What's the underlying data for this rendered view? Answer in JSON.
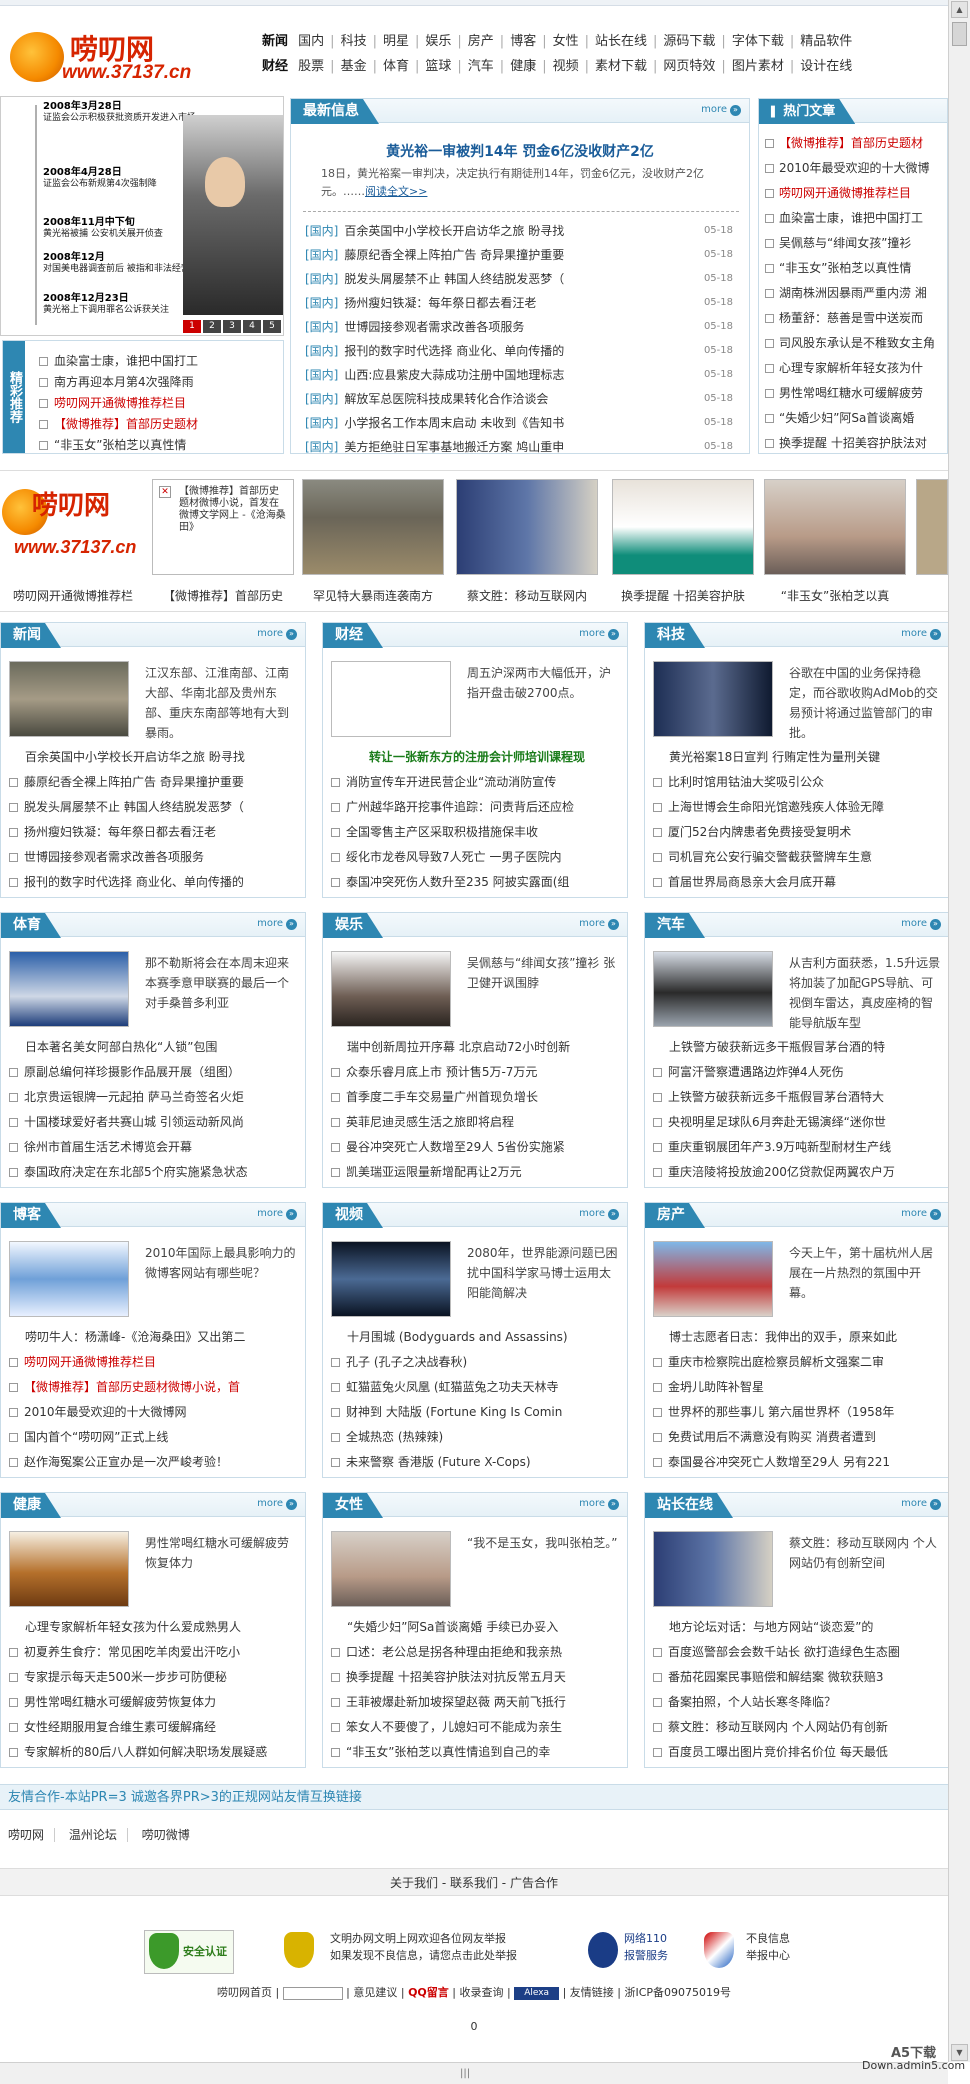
{
  "header": {
    "logo_text": "唠叨网",
    "logo_url": "www.37137.cn",
    "nav_row1": {
      "group": "新闻",
      "items": [
        "国内",
        "科技",
        "明星",
        "娱乐",
        "房产",
        "博客",
        "女性",
        "站长在线",
        "源码下载",
        "字体下载",
        "精品软件"
      ]
    },
    "nav_row2": {
      "group": "财经",
      "items": [
        "股票",
        "基金",
        "体育",
        "篮球",
        "汽车",
        "健康",
        "视频",
        "素材下载",
        "网页特效",
        "图片素材",
        "设计在线"
      ]
    }
  },
  "timeline": {
    "items": [
      {
        "date": "2008年3月28日",
        "text": "证监会公示积极获批资质开发进入市场"
      },
      {
        "date": "2008年4月28日",
        "text": "证监会公布新规第4次强制降"
      },
      {
        "date": "2008年11月中下旬",
        "text": "黄光裕被捕 公安机关展开侦查"
      },
      {
        "date": "2008年12月",
        "text": "对国美电器调查前后 被指和非法经营罪起诉"
      },
      {
        "date": "2008年12月23日",
        "text": "黄光裕上下调用罪名公诉获关注"
      }
    ],
    "pager": [
      "1",
      "2",
      "3",
      "4",
      "5"
    ]
  },
  "featured": {
    "label": "精彩推荐",
    "items": [
      "血染富士康，谁把中国打工",
      "南方再迎本月第4次强降雨",
      "唠叨网开通微博推荐栏目",
      "【微博推荐】首部历史题材",
      "“非玉女”张柏芝以真性情"
    ]
  },
  "latest": {
    "title": "最新信息",
    "more": "more",
    "lead_title": "黄光裕一审被判14年 罚金6亿没收财产2亿",
    "lead_summary": "18日，黄光裕案一审判决，决定执行有期徒刑14年，罚金6亿元，没收财产2亿元。……",
    "lead_link": "阅读全文>>",
    "items": [
      {
        "cat": "[国内]",
        "title": "百余英国中小学校长开启访华之旅 盼寻找",
        "date": "05-18"
      },
      {
        "cat": "[国内]",
        "title": "藤原纪香全裸上阵拍广告 奇异果撞护重要",
        "date": "05-18"
      },
      {
        "cat": "[国内]",
        "title": "脱发头屑屡禁不止 韩国人终结脱发恶梦（",
        "date": "05-18"
      },
      {
        "cat": "[国内]",
        "title": "扬州瘦妇铁凝：每年祭日都去看汪老",
        "date": "05-18"
      },
      {
        "cat": "[国内]",
        "title": "世博园接参观者需求改善各项服务",
        "date": "05-18"
      },
      {
        "cat": "[国内]",
        "title": "报刊的数字时代选择 商业化、单向传播的",
        "date": "05-18"
      },
      {
        "cat": "[国内]",
        "title": "山西:应县紫皮大蒜成功注册中国地理标志",
        "date": "05-18"
      },
      {
        "cat": "[国内]",
        "title": "解放军总医院科技成果转化合作洽谈会",
        "date": "05-18"
      },
      {
        "cat": "[国内]",
        "title": "小学报名工作本周末启动 未收到《告知书",
        "date": "05-18"
      },
      {
        "cat": "[国内]",
        "title": "美方拒绝驻日军事基地搬迁方案 鸠山重申",
        "date": "05-18"
      }
    ]
  },
  "hot": {
    "title": "热门文章",
    "items": [
      "【微博推荐】首部历史题材",
      "2010年最受欢迎的十大微博",
      "唠叨网开通微博推荐栏目",
      "血染富士康，谁把中国打工",
      "吴佩慈与“绯闻女孩”撞衫",
      "“非玉女”张柏芝以真性情",
      "湖南株洲因暴雨严重内涝 湘",
      "杨董舒：慈善是雪中送炭而",
      "司风股东承认是不稚致女主角",
      "心理专家解析年轻女孩为什",
      "男性常喝红糖水可缓解疲劳",
      "“失婚少妇”阿Sa首谈离婚",
      "换季提醒 十招美容护肤法对"
    ]
  },
  "strip": {
    "items": [
      "唠叨网开通微博推荐栏",
      "【微博推荐】首部历史",
      "罕见特大暴雨连袭南方",
      "蔡文胜：移动互联网内",
      "换季提醒 十招美容护肤",
      "“非玉女”张柏芝以真"
    ],
    "broken_img_text": "【微博推荐】首部历史题材微博小说，首发在微博文学网上 -《沧海桑田》"
  },
  "categories": [
    {
      "title": "新闻",
      "more": "more",
      "summary": "江汉东部、江淮南部、江南大部、华南北部及贵州东部、重庆东南部等地有大到暴雨。",
      "items": [
        {
          "t": "百余英国中小学校长开启访华之旅 盼寻找",
          "k": "p"
        },
        {
          "t": "藤原纪香全裸上阵拍广告 奇异果撞护重要",
          "k": "b"
        },
        {
          "t": "脱发头屑屡禁不止 韩国人终结脱发恶梦（",
          "k": "b"
        },
        {
          "t": "扬州瘦妇铁凝：每年祭日都去看汪老",
          "k": "b"
        },
        {
          "t": "世博园接参观者需求改善各项服务",
          "k": "b"
        },
        {
          "t": "报刊的数字时代选择 商业化、单向传播的",
          "k": "b"
        }
      ]
    },
    {
      "title": "财经",
      "more": "more",
      "summary": "周五沪深两市大幅低开，沪指开盘击破2700点。",
      "items": [
        {
          "t": "转让一张新东方的注册会计师培训课程现",
          "k": "g"
        },
        {
          "t": "消防宣传车开进民营企业“流动消防宣传",
          "k": "b"
        },
        {
          "t": "广州越华路开挖事件追踪：问责背后还应检",
          "k": "b"
        },
        {
          "t": "全国零售主产区采取积极措施保丰收",
          "k": "b"
        },
        {
          "t": "绥化市龙卷风导致7人死亡 一男子医院内",
          "k": "b"
        },
        {
          "t": "泰国冲突死伤人数升至235 阿披实露面(组",
          "k": "b"
        }
      ]
    },
    {
      "title": "科技",
      "more": "more",
      "summary": "谷歌在中国的业务保持稳定，而谷歌收购AdMob的交易预计将通过监管部门的审批。",
      "items": [
        {
          "t": "黄光裕案18日宣判 行贿定性为量刑关键",
          "k": "p"
        },
        {
          "t": "比利时馆用钴油大奖吸引公众",
          "k": "b"
        },
        {
          "t": "上海世博会生命阳光馆邀残疾人体验无障",
          "k": "b"
        },
        {
          "t": "厦门52台内牌患者免费接受复明术",
          "k": "b"
        },
        {
          "t": "司机冒充公安行骗交警截获警牌车生意",
          "k": "b"
        },
        {
          "t": "首届世界局商恳亲大会月底开幕",
          "k": "b"
        }
      ]
    },
    {
      "title": "体育",
      "more": "more",
      "summary": "那不勒斯将会在本周末迎来本赛季意甲联赛的最后一个对手桑普多利亚",
      "items": [
        {
          "t": "日本著名美女阿部白热化“人锁”包围",
          "k": "p"
        },
        {
          "t": "原副总编何祥珍摄影作品展开展（组图）",
          "k": "b"
        },
        {
          "t": "北京贵运银牌一元起拍 萨马兰奇签名火炬",
          "k": "b"
        },
        {
          "t": "十国楼球爱好者共赛山城 引领运动新风尚",
          "k": "b"
        },
        {
          "t": "徐州市首届生活艺术博览会开幕",
          "k": "b"
        },
        {
          "t": "泰国政府决定在东北部5个府实施紧急状态",
          "k": "b"
        }
      ]
    },
    {
      "title": "娱乐",
      "more": "more",
      "summary": "吴佩慈与“绯闻女孩”撞衫 张卫健开讽围脖",
      "items": [
        {
          "t": "瑞中创新周拉开序幕 北京启动72小时创新",
          "k": "p"
        },
        {
          "t": "众泰乐睿月底上市 预计售5万-7万元",
          "k": "b"
        },
        {
          "t": "首季度二手车交易量广州首现负增长",
          "k": "b"
        },
        {
          "t": "英菲尼迪灵感生活之旅即将启程",
          "k": "b"
        },
        {
          "t": "曼谷冲突死亡人数增至29人 5省份实施紧",
          "k": "b"
        },
        {
          "t": "凯美瑞亚运限量新增配再让2万元",
          "k": "b"
        }
      ]
    },
    {
      "title": "汽车",
      "more": "more",
      "summary": "从吉利方面获悉，1.5升远景将加装了加配GPS导航、可视倒车雷达，真皮座椅的智能导航版车型",
      "items": [
        {
          "t": "上铁警方破获新远多干瓶假冒茅台酒的特",
          "k": "p"
        },
        {
          "t": "阿富汗警察遭遇路边炸弹4人死伤",
          "k": "b"
        },
        {
          "t": "上铁警方破获新远多千瓶假冒茅台酒特大",
          "k": "b"
        },
        {
          "t": "央视明星足球队6月奔赴无锡演绎“迷你世",
          "k": "b"
        },
        {
          "t": "重庆重钢展团年产3.9万吨新型耐材生产线",
          "k": "b"
        },
        {
          "t": "重庆涪陵将投放逾200亿贷款促两翼农户万",
          "k": "b"
        }
      ]
    },
    {
      "title": "博客",
      "more": "more",
      "summary": "2010年国际上最具影响力的微博客网站有哪些呢？",
      "items": [
        {
          "t": "唠叨牛人：杨潇峰-《沧海桑田》又出第二",
          "k": "p"
        },
        {
          "t": "唠叨网开通微博推荐栏目",
          "k": "r"
        },
        {
          "t": "【微博推荐】首部历史题材微博小说，首",
          "k": "r"
        },
        {
          "t": "2010年最受欢迎的十大微博网",
          "k": "b"
        },
        {
          "t": "国内首个“唠叨网”正式上线",
          "k": "b"
        },
        {
          "t": "赵作海冤案公正宣办是一次严峻考验！",
          "k": "b"
        }
      ]
    },
    {
      "title": "视频",
      "more": "more",
      "summary": "2080年，世界能源问题已困扰中国科学家马博士运用太阳能简解决",
      "items": [
        {
          "t": "十月围城 (Bodyguards and Assassins)",
          "k": "p"
        },
        {
          "t": "孔子 (孔子之决战春秋)",
          "k": "b"
        },
        {
          "t": "虹猫蓝兔火凤凰 (虹猫蓝兔之功夫天林寺",
          "k": "b"
        },
        {
          "t": "财神到 大陆版 (Fortune King Is Comin",
          "k": "b"
        },
        {
          "t": "全城热恋 (热辣辣)",
          "k": "b"
        },
        {
          "t": "未来警察 香港版 (Future X-Cops)",
          "k": "b"
        }
      ]
    },
    {
      "title": "房产",
      "more": "more",
      "summary": "今天上午，第十届杭州人居展在一片热烈的氛围中开幕。",
      "items": [
        {
          "t": "博士志愿者日志：我伸出的双手，原来如此",
          "k": "p"
        },
        {
          "t": "重庆市检察院出庭检察员解析文强案二审",
          "k": "b"
        },
        {
          "t": "金坍儿助阵补智星",
          "k": "b"
        },
        {
          "t": "世界杯的那些事儿 第六届世界杯（1958年",
          "k": "b"
        },
        {
          "t": "免费试用后不满意没有购买 消费者遭到",
          "k": "b"
        },
        {
          "t": "泰国曼谷冲突死亡人数增至29人 另有221",
          "k": "b"
        }
      ]
    },
    {
      "title": "健康",
      "more": "more",
      "summary": "男性常喝红糖水可缓解疲劳恢复体力",
      "items": [
        {
          "t": "心理专家解析年轻女孩为什么爱成熟男人",
          "k": "p"
        },
        {
          "t": "初夏养生食疗：常见困吃羊肉爱出汗吃小",
          "k": "b"
        },
        {
          "t": "专家提示每天走500米一步步可防便秘",
          "k": "b"
        },
        {
          "t": "男性常喝红糖水可缓解疲劳恢复体力",
          "k": "b"
        },
        {
          "t": "女性经期服用复合维生素可缓解痛经",
          "k": "b"
        },
        {
          "t": "专家解析的80后八人群如何解决职场发展疑惑",
          "k": "b"
        }
      ]
    },
    {
      "title": "女性",
      "more": "more",
      "summary": "“我不是玉女，我叫张柏芝。”",
      "items": [
        {
          "t": "“失婚少妇”阿Sa首谈离婚 手续已办妥入",
          "k": "p"
        },
        {
          "t": "口述：老公总是拐各种理由拒绝和我亲热",
          "k": "b"
        },
        {
          "t": "换季提醒 十招美容护肤法对抗反常五月天",
          "k": "b"
        },
        {
          "t": "王菲被爆赴新加坡探望赵薇 两天前飞抵行",
          "k": "b"
        },
        {
          "t": "笨女人不要傻了，儿媳妇可不能成为亲生",
          "k": "b"
        },
        {
          "t": "“非玉女”张柏芝以真性情追到自己的幸",
          "k": "b"
        }
      ]
    },
    {
      "title": "站长在线",
      "more": "more",
      "summary": "蔡文胜：移动互联网内 个人网站仍有创新空间",
      "items": [
        {
          "t": "地方论坛对话：与地方网站“谈恋爱”的",
          "k": "p"
        },
        {
          "t": "百度巡警部会会数千站长 欲打造绿色生态圈",
          "k": "b"
        },
        {
          "t": "番茄花园案民事赔偿和解结案 微软获赔3",
          "k": "b"
        },
        {
          "t": "备案拍照，个人站长寒冬降临？",
          "k": "b"
        },
        {
          "t": "蔡文胜：移动互联网内 个人网站仍有创新",
          "k": "b"
        },
        {
          "t": "百度员工曝出图片竞价排名价位 每天最低",
          "k": "b"
        }
      ]
    }
  ],
  "friend": {
    "bar_text": "友情合作-本站PR=3 诚邀各界PR>3的正规网站友情互换链接",
    "links": [
      "唠叨网",
      "温州论坛",
      "唠叨微博"
    ]
  },
  "footer": {
    "links_bar": "关于我们 - 联系我们 - 广告合作",
    "badge1": "安全认证",
    "badge2_line1": "文明办网文明上网欢迎各位网友举报",
    "badge2_line2": "如果发现不良信息，请您点击此处举报",
    "badge3_line1": "网络110",
    "badge3_line2": "报警服务",
    "badge4_line1": "不良信息",
    "badge4_line2": "举报中心",
    "bottom_links": [
      "唠叨网首页",
      "意见建议",
      "QQ留言",
      "收录查询",
      "Alexa",
      "友情链接",
      "浙ICP备09075019号"
    ],
    "counter": "0"
  },
  "watermark": {
    "line1": "A5下载",
    "line2": "Down.admin5.com"
  }
}
